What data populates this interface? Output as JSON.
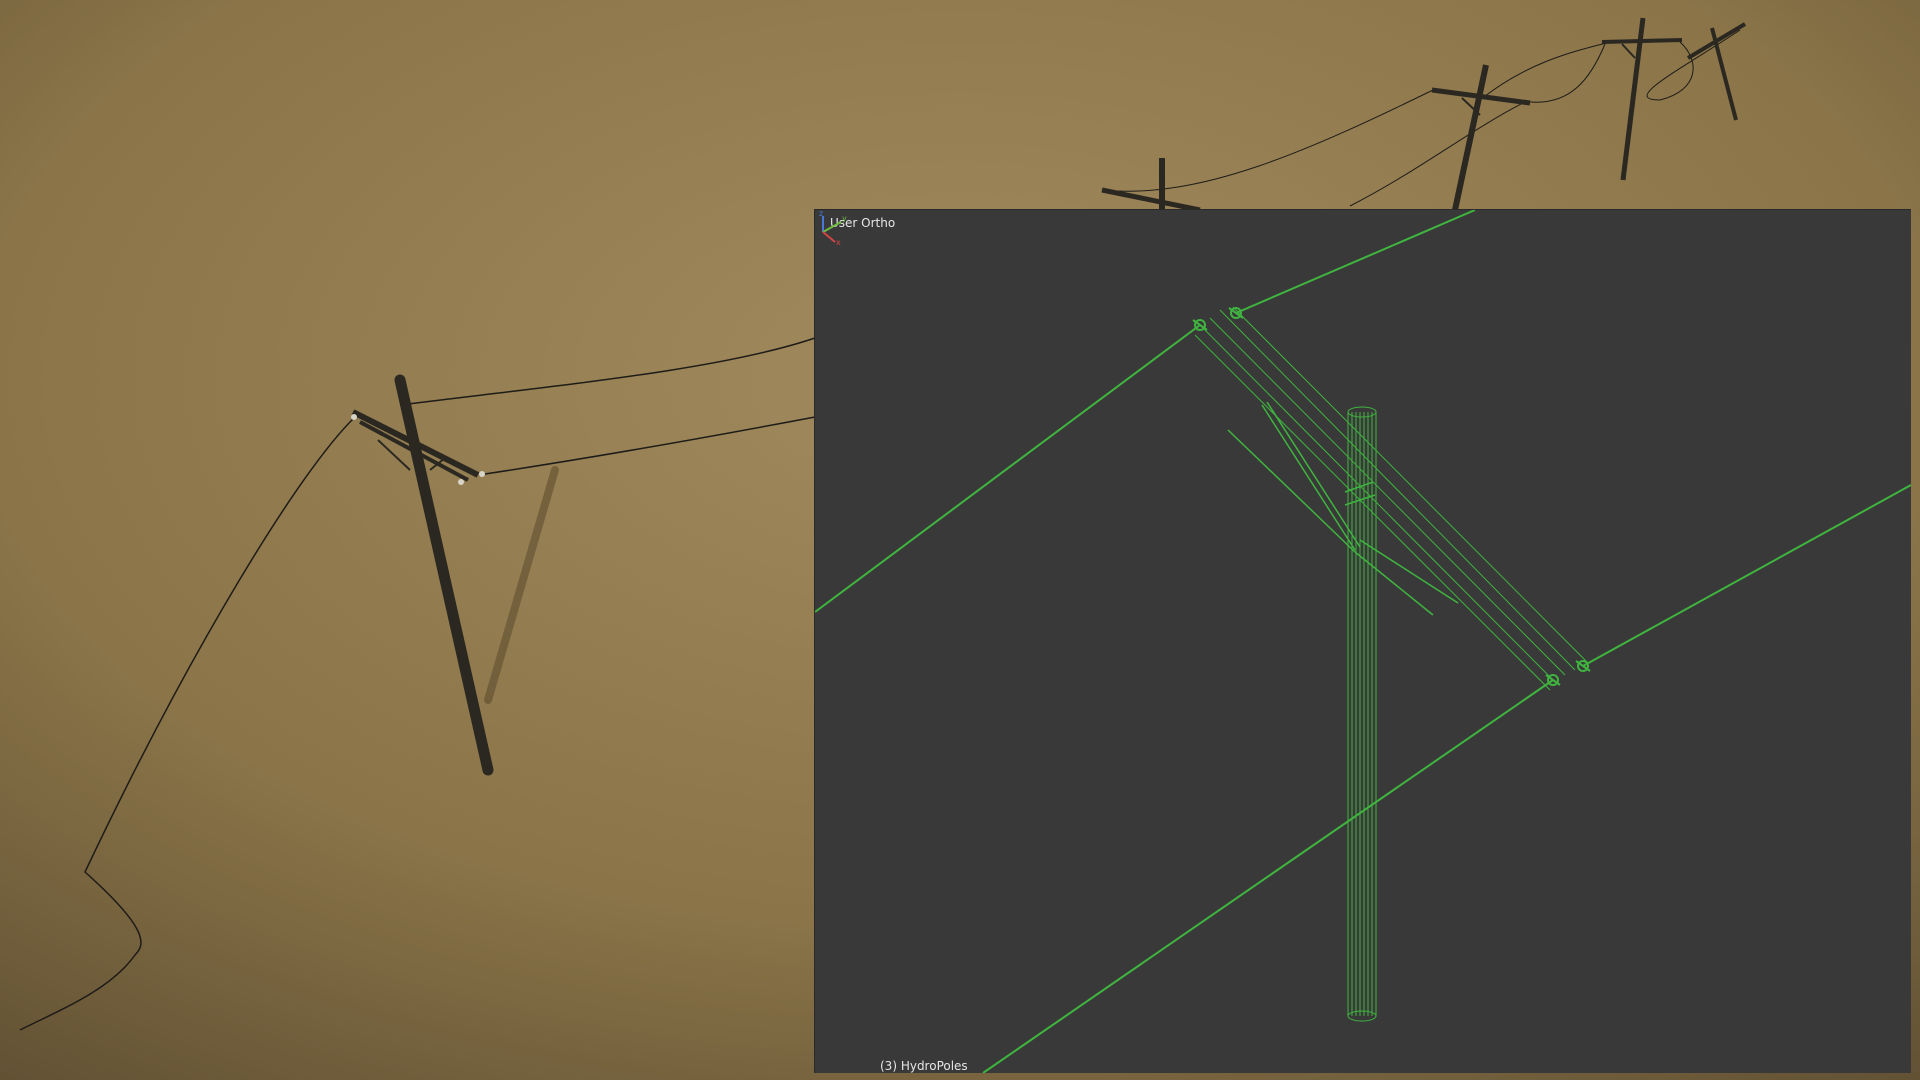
{
  "viewport": {
    "view_name": "User Ortho",
    "object_label": "(3) HydroPoles",
    "axes": {
      "x": "x",
      "y": "y",
      "z": "z"
    }
  },
  "colors": {
    "background_light": "#a08a5e",
    "background_dark": "#5e4e32",
    "pole": "#2b2821",
    "wire": "#1e1c18",
    "viewport_bg": "#393939",
    "wireframe": "#3fb53f",
    "axis_x": "#d24545",
    "axis_y": "#6fbd3c",
    "axis_z": "#4a78d6"
  }
}
